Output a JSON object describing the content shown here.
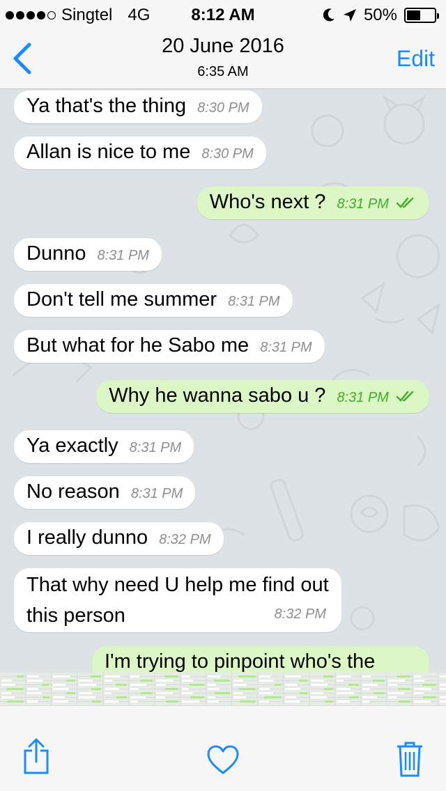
{
  "status_bar": {
    "carrier": "Singtel",
    "network": "4G",
    "time": "8:12 AM",
    "battery": "50%",
    "battery_level": 0.5,
    "signal_bars": 4
  },
  "nav": {
    "title": "20 June 2016",
    "subtitle": "6:35 AM",
    "edit_label": "Edit"
  },
  "colors": {
    "accent": "#1a8cff",
    "outgoing_bubble": "#dcf7c5",
    "incoming_bubble": "#ffffff",
    "read_ticks": "#3fae2a"
  },
  "messages": [
    {
      "text": "Ya that's the thing",
      "time": "8:30 PM",
      "direction": "in"
    },
    {
      "text": "Allan is nice to me",
      "time": "8:30 PM",
      "direction": "in"
    },
    {
      "text": "Who's next ?",
      "time": "8:31 PM",
      "direction": "out",
      "read": true
    },
    {
      "text": "Dunno",
      "time": "8:31 PM",
      "direction": "in"
    },
    {
      "text": "Don't tell me summer",
      "time": "8:31 PM",
      "direction": "in"
    },
    {
      "text": "But what for he Sabo me",
      "time": "8:31 PM",
      "direction": "in"
    },
    {
      "text": "Why he wanna sabo u ?",
      "time": "8:31 PM",
      "direction": "out",
      "read": true
    },
    {
      "text": "Ya exactly",
      "time": "8:31 PM",
      "direction": "in"
    },
    {
      "text": "No reason",
      "time": "8:31 PM",
      "direction": "in"
    },
    {
      "text": "I really dunno",
      "time": "8:32 PM",
      "direction": "in"
    },
    {
      "text": "That why need U help me find out this person",
      "time": "8:32 PM",
      "direction": "in"
    },
    {
      "text": "I'm trying to pinpoint who's the",
      "time": "",
      "direction": "out"
    }
  ],
  "toolbar": {
    "share_icon": "share-icon",
    "favorite_icon": "heart-icon",
    "delete_icon": "trash-icon"
  }
}
